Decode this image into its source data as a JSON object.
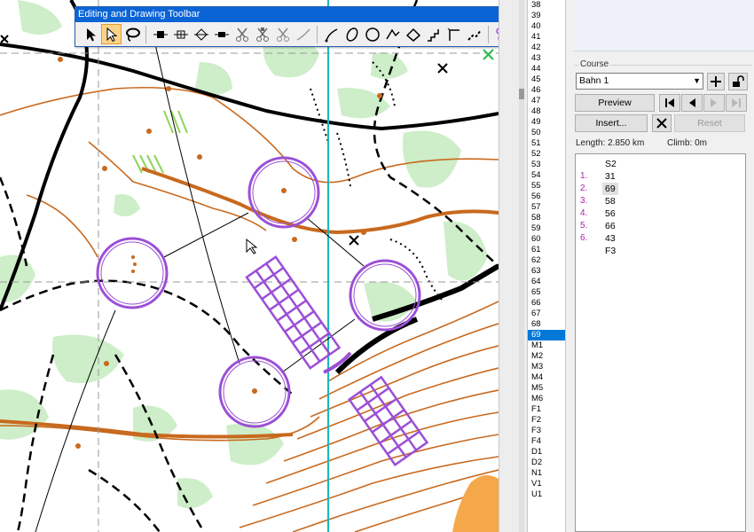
{
  "toolbar": {
    "title": "Editing and Drawing Toolbar",
    "menu_glyph": "▾",
    "close_glyph": "✕",
    "tools": [
      {
        "icon": "arrow-pointer-icon",
        "active": false
      },
      {
        "icon": "hollow-arrow-pointer-icon",
        "active": true
      },
      {
        "icon": "lasso-icon",
        "active": false
      },
      {
        "icon": "move-node-icon",
        "active": false
      },
      {
        "icon": "add-node-icon",
        "active": false
      },
      {
        "icon": "diamond-node-icon",
        "active": false
      },
      {
        "icon": "delete-node-icon",
        "active": false
      },
      {
        "icon": "cut-icon",
        "active": false
      },
      {
        "icon": "cut-area-icon",
        "active": false
      },
      {
        "icon": "cut-hole-icon",
        "active": false
      },
      {
        "icon": "smooth-icon",
        "active": false
      },
      {
        "icon": "curve-icon",
        "active": false
      },
      {
        "icon": "ellipse-icon",
        "active": false
      },
      {
        "icon": "circle-icon",
        "active": false
      },
      {
        "icon": "polyline-icon",
        "active": false
      },
      {
        "icon": "freehand-icon",
        "active": false
      },
      {
        "icon": "stairs-icon",
        "active": false
      },
      {
        "icon": "corner-line-icon",
        "active": false
      },
      {
        "icon": "dashed-curve-icon",
        "active": false
      },
      {
        "icon": "course-controls-icon",
        "active": false
      },
      {
        "icon": "triangle-start-icon",
        "active": false
      },
      {
        "icon": "control-circle-icon",
        "active": false
      },
      {
        "icon": "finish-circle-icon",
        "active": false
      },
      {
        "icon": "marked-route-icon",
        "active": false
      },
      {
        "icon": "out-of-bounds-icon",
        "active": false
      },
      {
        "icon": "check-mark-icon",
        "active": false
      },
      {
        "icon": "crossing-point-icon",
        "active": false
      },
      {
        "icon": "forbidden-cross-icon",
        "active": false
      },
      {
        "icon": "description-table-icon",
        "active": false
      }
    ]
  },
  "control_list": {
    "items": [
      "38",
      "39",
      "40",
      "41",
      "42",
      "43",
      "44",
      "45",
      "46",
      "47",
      "48",
      "49",
      "50",
      "51",
      "52",
      "53",
      "54",
      "55",
      "56",
      "57",
      "58",
      "59",
      "60",
      "61",
      "62",
      "63",
      "64",
      "65",
      "66",
      "67",
      "68",
      "69",
      "M1",
      "M2",
      "M3",
      "M4",
      "M5",
      "M6",
      "F1",
      "F2",
      "F3",
      "F4",
      "D1",
      "D2",
      "N1",
      "V1",
      "U1"
    ],
    "selected": "69"
  },
  "course_panel": {
    "group_label": "Course",
    "course_name": "Bahn 1",
    "preview_label": "Preview",
    "insert_label": "Insert...",
    "reset_label": "Reset",
    "length_text": "Length: 2.850 km",
    "climb_text": "Climb: 0m",
    "legs": [
      {
        "num": "",
        "code": "S2"
      },
      {
        "num": "1.",
        "code": "31"
      },
      {
        "num": "2.",
        "code": "69",
        "selected": true
      },
      {
        "num": "3.",
        "code": "58"
      },
      {
        "num": "4.",
        "code": "56"
      },
      {
        "num": "5.",
        "code": "66"
      },
      {
        "num": "6.",
        "code": "43"
      },
      {
        "num": "",
        "code": "F3"
      }
    ]
  },
  "colors": {
    "course_purple": "#9b4fd6",
    "contour_brown": "#c8691e",
    "vegetation_green": "#cdeec8",
    "selection_blue": "#0078d7",
    "titlebar_blue": "#0a64d6",
    "cyan_guide": "#18b8c0"
  }
}
